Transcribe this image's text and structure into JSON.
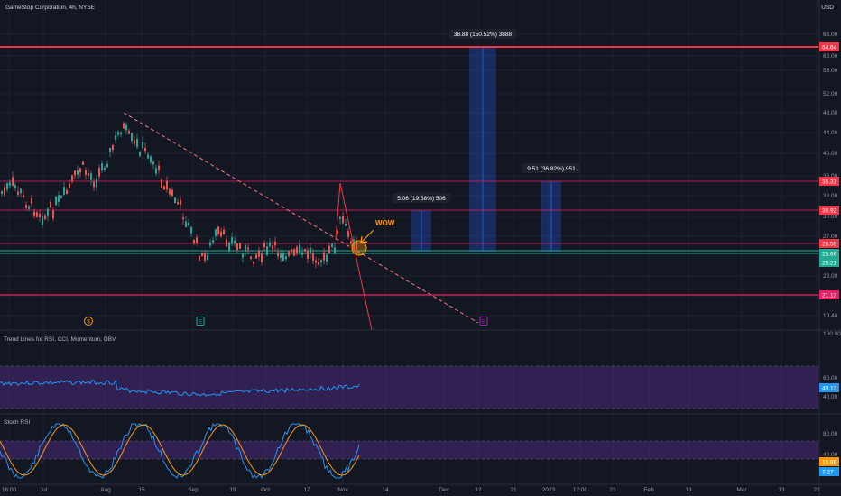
{
  "header": {
    "title": "GameStop Corporation, 4h, NYSE",
    "currency": "USD"
  },
  "colors": {
    "bg": "#131722",
    "grid": "#1e222d",
    "up": "#26a69a",
    "down": "#ef5350",
    "resistance": "#f23645",
    "support_green": "#22ab94",
    "pink": "#e91e63",
    "range_blue": "#2962ff",
    "rsi_band": "#4a2a7a",
    "rsi_line": "#2196f3",
    "stoch_k": "#2196f3",
    "stoch_d": "#ff9800",
    "trend": "#f77c80",
    "annotation": "#ff9800"
  },
  "price_axis": {
    "ticks": [
      "68.00",
      "63.00",
      "58.00",
      "52.00",
      "48.00",
      "44.00",
      "40.00",
      "36.00",
      "33.00",
      "30.00",
      "27.00",
      "23.00",
      "21.00",
      "19.40"
    ],
    "tags": [
      {
        "text": "64.64",
        "color": "#f23645"
      },
      {
        "text": "35.31",
        "color": "#f23645"
      },
      {
        "text": "30.92",
        "color": "#f23645"
      },
      {
        "text": "26.59",
        "color": "#f23645"
      },
      {
        "text": "25.66",
        "color": "#22ab94"
      },
      {
        "text": "25.21",
        "color": "#22ab94"
      },
      {
        "text": "21.13",
        "color": "#e91e63"
      }
    ]
  },
  "ranges": [
    {
      "label": "38.88 (150.52%) 3888"
    },
    {
      "label": "5.06 (19.58%) 506"
    },
    {
      "label": "9.51 (36.82%) 951"
    }
  ],
  "annotation": {
    "text": "WOW"
  },
  "events": [
    {
      "symbol": "$",
      "color": "#ff9800"
    },
    {
      "symbol": "E",
      "color": "#26a69a"
    },
    {
      "symbol": "E",
      "color": "#9c27b0"
    }
  ],
  "rsi_panel": {
    "title": "Trend Lines for RSI, CCI, Momentum, OBV",
    "ticks": [
      "100.00",
      "60.00",
      "40.00"
    ],
    "value_tag": "49.13"
  },
  "stoch_panel": {
    "title": "Stoch RSI",
    "ticks": [
      "80.00",
      "40.00"
    ],
    "k_tag": "15.86",
    "d_tag": "7.27"
  },
  "time_axis": [
    "16:00",
    "Jul",
    "Aug",
    "15",
    "Sep",
    "19",
    "Oct",
    "17",
    "Nov",
    "14",
    "Dec",
    "12",
    "21",
    "2023",
    "12:00",
    "23",
    "Feb",
    "13",
    "Mar",
    "13",
    "22"
  ]
}
